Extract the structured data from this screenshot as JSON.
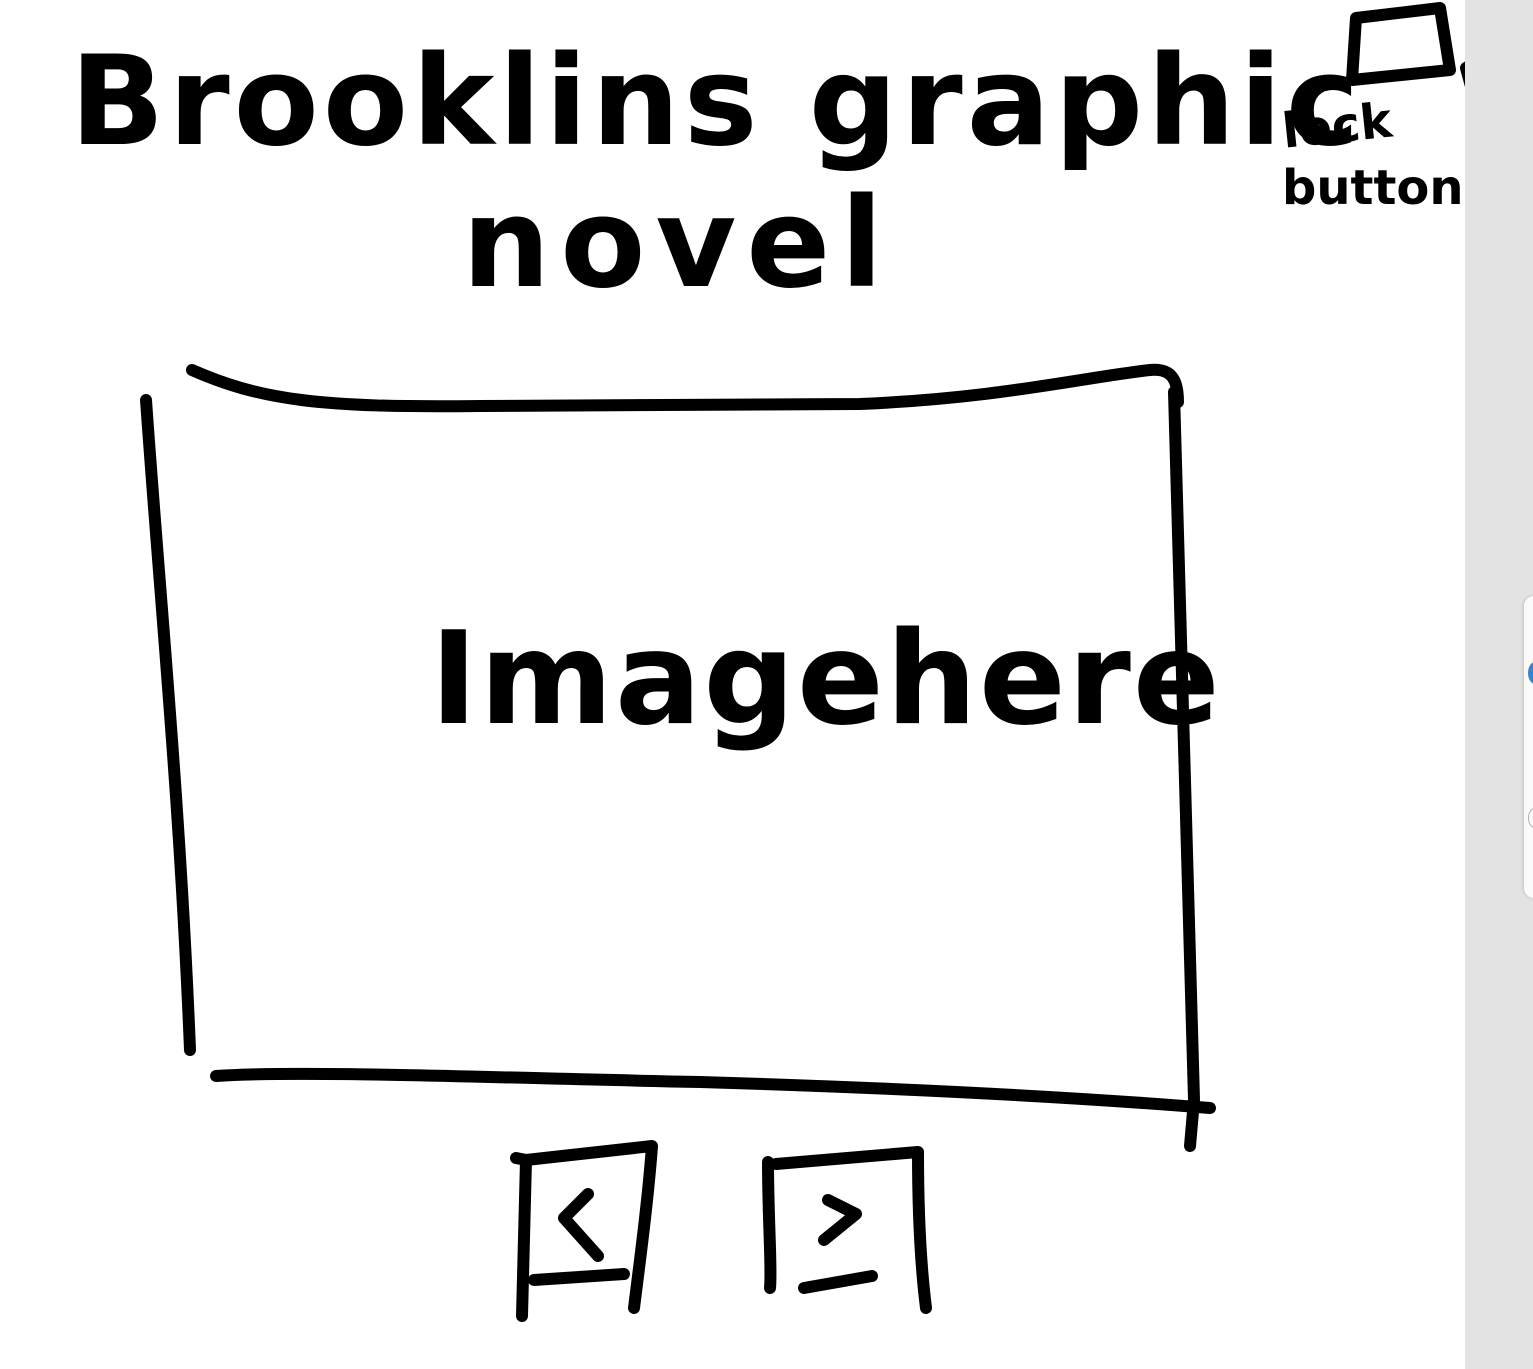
{
  "title": {
    "line1": "Brooklins graphic",
    "line2": "novel"
  },
  "lock_annotation": {
    "label_line1": "lock",
    "label_line2": "button",
    "icon": "lock-button-icon"
  },
  "image_area": {
    "label": "Imagehere"
  },
  "navigation": {
    "prev": {
      "glyph": "<",
      "icon": "chevron-left-icon"
    },
    "next": {
      "glyph": ">",
      "icon": "chevron-right-icon"
    }
  },
  "colors": {
    "ink": "#000000",
    "paper": "#ffffff",
    "gutter": "#e3e3e3",
    "accent": "#2f86d9"
  }
}
